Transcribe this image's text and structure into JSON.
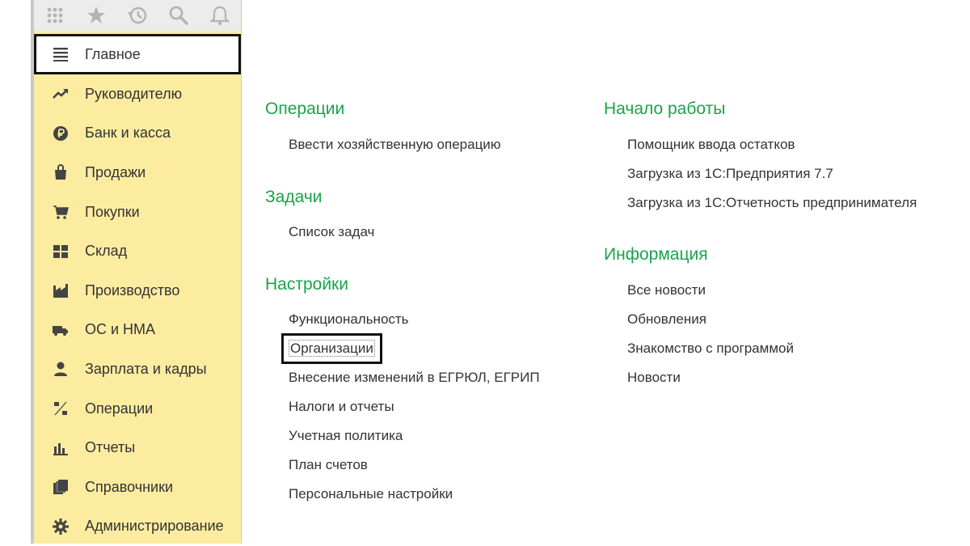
{
  "toolbar": {
    "icons": [
      "apps-grid-icon",
      "favorites-star-icon",
      "history-icon",
      "search-icon",
      "notifications-bell-icon"
    ]
  },
  "sidebar": {
    "items": [
      {
        "label": "Главное",
        "icon": "menu-lines-icon",
        "active": true
      },
      {
        "label": "Руководителю",
        "icon": "trend-icon",
        "active": false
      },
      {
        "label": "Банк и касса",
        "icon": "ruble-coin-icon",
        "active": false
      },
      {
        "label": "Продажи",
        "icon": "shopping-bag-icon",
        "active": false
      },
      {
        "label": "Покупки",
        "icon": "cart-icon",
        "active": false
      },
      {
        "label": "Склад",
        "icon": "warehouse-grid-icon",
        "active": false
      },
      {
        "label": "Производство",
        "icon": "factory-icon",
        "active": false
      },
      {
        "label": "ОС и НМА",
        "icon": "truck-icon",
        "active": false
      },
      {
        "label": "Зарплата и кадры",
        "icon": "person-icon",
        "active": false
      },
      {
        "label": "Операции",
        "icon": "debit-credit-icon",
        "active": false
      },
      {
        "label": "Отчеты",
        "icon": "bar-chart-icon",
        "active": false
      },
      {
        "label": "Справочники",
        "icon": "books-icon",
        "active": false
      },
      {
        "label": "Администрирование",
        "icon": "gear-icon",
        "active": false
      }
    ]
  },
  "operations": {
    "title": "Операции",
    "links": [
      "Ввести хозяйственную операцию"
    ]
  },
  "tasks": {
    "title": "Задачи",
    "links": [
      "Список задач"
    ]
  },
  "settings": {
    "title": "Настройки",
    "links": [
      "Функциональность",
      "Организации",
      "Внесение изменений в ЕГРЮЛ, ЕГРИП",
      "Налоги и отчеты",
      "Учетная политика",
      "План счетов",
      "Персональные настройки"
    ]
  },
  "start": {
    "title": "Начало работы",
    "links": [
      "Помощник ввода остатков",
      "Загрузка из 1С:Предприятия 7.7",
      "Загрузка из 1С:Отчетность предпринимателя"
    ]
  },
  "info": {
    "title": "Информация",
    "links": [
      "Все новости",
      "Обновления",
      "Знакомство с программой",
      "Новости"
    ]
  },
  "colors": {
    "sidebar_bg": "#fbeca0",
    "section_title": "#1aa34a",
    "highlight_border": "#111111"
  }
}
